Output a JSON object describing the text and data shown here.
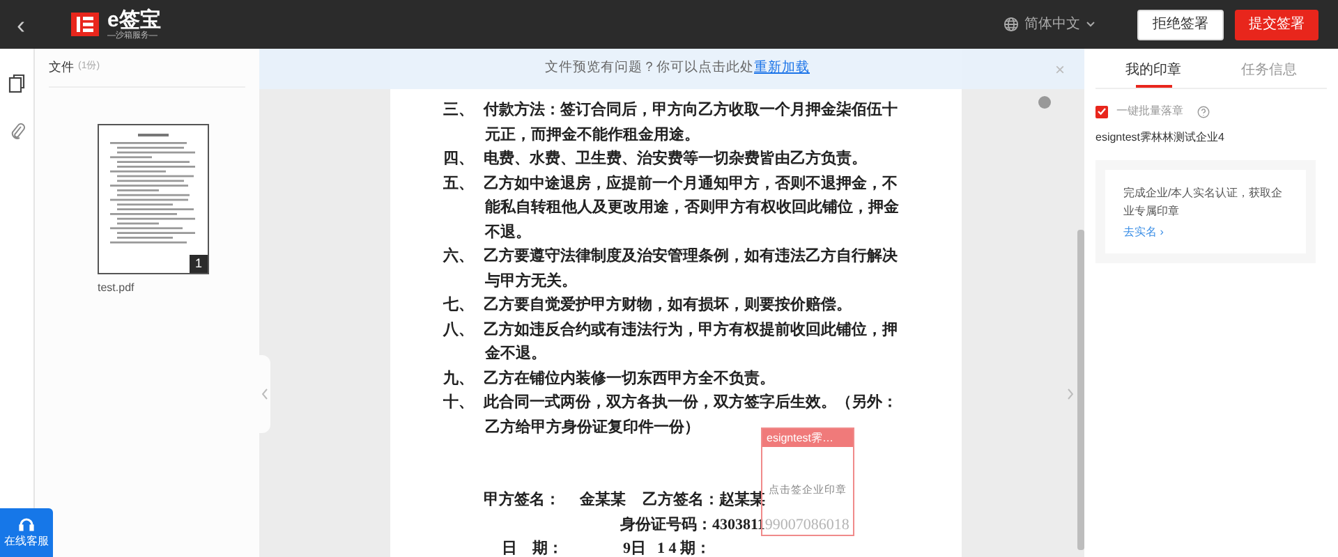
{
  "header": {
    "back": "‹",
    "logo_text": "e签宝",
    "logo_subtitle": "—沙箱服务—",
    "language": "简体中文",
    "buttons": [
      {
        "label": "拒绝签署",
        "kind": "secondary"
      },
      {
        "label": "提交签署",
        "kind": "primary"
      }
    ]
  },
  "file_panel": {
    "title": "文件",
    "count": "(1份)",
    "files": [
      {
        "name": "test.pdf",
        "page_badge": "1"
      }
    ]
  },
  "notice": {
    "text": "文件预览有问题？你可以点击此处",
    "link": "重新加载",
    "close": "×"
  },
  "document": {
    "clauses": [
      {
        "number": "三、",
        "lines": [
          "付款方法：签订合同后，甲方向乙方收取一个月押金柒佰伍十",
          "元正，而押金不能作租金用途。"
        ]
      },
      {
        "number": "四、",
        "lines": [
          "电费、水费、卫生费、治安费等一切杂费皆由乙方负责。"
        ]
      },
      {
        "number": "五、",
        "lines": [
          "乙方如中途退房，应提前一个月通知甲方，否则不退押金，不",
          "能私自转租他人及更改用途，否则甲方有权收回此铺位，押金",
          "不退。"
        ]
      },
      {
        "number": "六、",
        "lines": [
          "乙方要遵守法律制度及治安管理条例，如有违法乙方自行解决",
          "与甲方无关。"
        ]
      },
      {
        "number": "七、",
        "lines": [
          "乙方要自觉爱护甲方财物，如有损坏，则要按价赔偿。"
        ]
      },
      {
        "number": "八、",
        "lines": [
          "乙方如违反合约或有违法行为，甲方有权提前收回此铺位，押",
          "金不退。"
        ]
      },
      {
        "number": "九、",
        "lines": [
          "乙方在铺位内装修一切东西甲方全不负责。"
        ]
      },
      {
        "number": "十、",
        "lines": [
          "此合同一式两份，双方各执一份，双方签字后生效。（另外：",
          "乙方给甲方身份证复印件一份）"
        ]
      }
    ],
    "signatures": {
      "party_a": "甲方签名：",
      "party_a_name": "金某某",
      "party_b": "乙方签名：赵某某",
      "id_label": "身份证号码：4303811",
      "id_rest": "99007086018",
      "date_label": "日　期：",
      "date_day": "9日",
      "date_rest": "1 4 期："
    },
    "seal_field": {
      "title": "esigntest霁…",
      "hint": "点击签企业印章"
    }
  },
  "right_panel": {
    "tabs": [
      {
        "label": "我的印章",
        "selected": true
      },
      {
        "label": "任务信息",
        "selected": false
      }
    ],
    "batch_seal": {
      "label": "一键批量落章",
      "checked": true
    },
    "company": "esigntest霁林林测试企业4",
    "card": {
      "text": "完成企业/本人实名认证，获取企业专属印章",
      "link": "去实名 ›"
    }
  },
  "support": {
    "label": "在线客服"
  }
}
